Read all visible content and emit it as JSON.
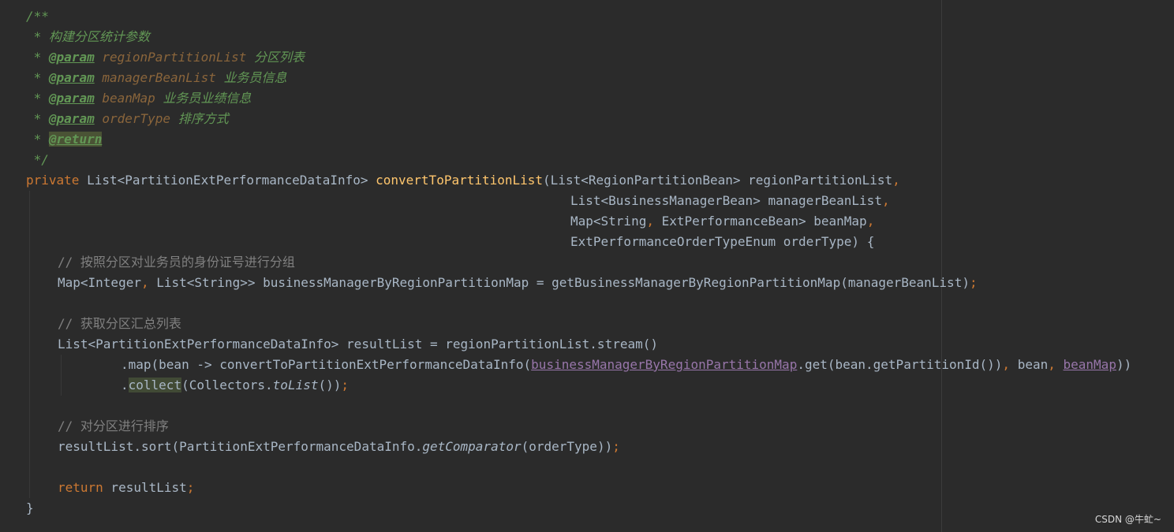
{
  "doc": {
    "open": "/**",
    "desc": " * 构建分区统计参数",
    "star": " * ",
    "tag_param": "@param",
    "p1_name": "regionPartitionList",
    "p1_desc": "分区列表",
    "p2_name": "managerBeanList",
    "p2_desc": "业务员信息",
    "p3_name": "beanMap",
    "p3_desc": "业务员业绩信息",
    "p4_name": "orderType",
    "p4_desc": "排序方式",
    "tag_return": "@return",
    "close": " */"
  },
  "sig": {
    "private": "private",
    "ret_type": " List<PartitionExtPerformanceDataInfo> ",
    "method": "convertToPartitionList",
    "arg1_type": "(List<RegionPartitionBean> regionPartitionList",
    "arg2_type": "List<BusinessManagerBean> managerBeanList",
    "arg3_a": "Map<String",
    "arg3_b": " ExtPerformanceBean> beanMap",
    "arg4_a": "ExtPerformanceOrderTypeEnum ",
    "arg4_b": "orderType",
    "arg4_c": ") {",
    "comma": ","
  },
  "body": {
    "comment1": "// 按照分区对业务员的身份证号进行分组",
    "l1_a": "Map<Integer",
    "l1_b": " List<String>> businessManagerByRegionPartitionMap = getBusinessManagerByRegionPartitionMap(managerBeanList)",
    "comment2": "// 获取分区汇总列表",
    "l2": "List<PartitionExtPerformanceDataInfo> resultList = regionPartitionList.stream()",
    "l3_a": ".map(bean -> convertToPartitionExtPerformanceDataInfo(",
    "l3_field1": "businessManagerByRegionPartitionMap",
    "l3_b": ".get(bean.getPartitionId())",
    "l3_c": " bean",
    "l3_field2": "beanMap",
    "l3_d": "))",
    "l4_dot": ".",
    "l4_collect": "collect",
    "l4_a": "(Collectors.",
    "l4_tolist": "toList",
    "l4_b": "())",
    "comment3": "// 对分区进行排序",
    "l5_a": "resultList.sort(PartitionExtPerformanceDataInfo.",
    "l5_get": "getComparator",
    "l5_b": "(orderType))",
    "ret_kw": "return",
    "ret_val": " resultList",
    "semi": ";",
    "close": "}"
  },
  "watermark": "CSDN @牛虻~"
}
